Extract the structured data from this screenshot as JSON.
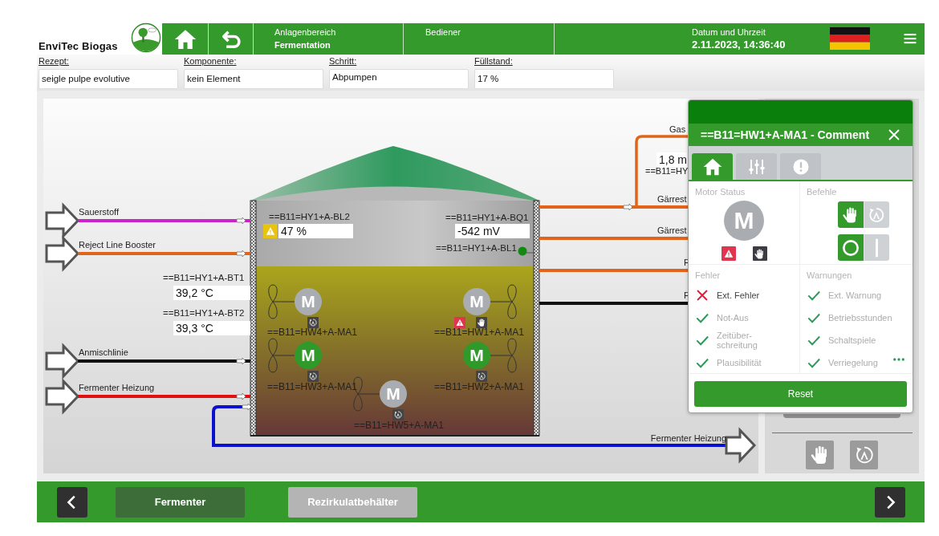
{
  "header": {
    "logo_text": "EnviTec Biogas",
    "area_label": "Anlagenbereich",
    "area_value": "Fermentation",
    "operator_label": "Bediener",
    "datetime_label": "Datum und Uhrzeit",
    "datetime_value": "2.11.2023, 14:36:40"
  },
  "info_fields": [
    {
      "label": "Rezept:",
      "value": "seigle pulpe evolutive"
    },
    {
      "label": "Komponente:",
      "value": "kein Element"
    },
    {
      "label": "Schritt:",
      "value": "Abpumpen"
    },
    {
      "label": "Füllstand:",
      "value": "17 %"
    }
  ],
  "diagram": {
    "inlets": [
      {
        "label": "Sauerstoff",
        "color": "#cc22cc"
      },
      {
        "label": "Reject Line Booster",
        "color": "#e0651a"
      },
      {
        "label": "Anmischlinie",
        "color": "#111111"
      },
      {
        "label": "Fermenter Heizung",
        "color": "#e01010"
      }
    ],
    "outlets": [
      {
        "label": "Gärrest",
        "color": "#e0651a"
      },
      {
        "label": "Gärrest",
        "color": "#e0651a"
      },
      {
        "label": "F",
        "color": "#e0651a"
      },
      {
        "label": "F",
        "color": "#111111"
      }
    ],
    "gas_line": {
      "label": "Gas",
      "value": "1,8 m",
      "tag": "==B11=HY"
    },
    "return_line": {
      "label": "Fermenter Heizung",
      "color": "#0a10d0"
    },
    "sensors": [
      {
        "kind": "value",
        "tag": "==B11=HY1+A-BL2",
        "value": "47 %",
        "warning": true
      },
      {
        "kind": "value",
        "tag": "==B11=HY1+A-BQ1",
        "value": "-542 mV",
        "warning": false
      },
      {
        "kind": "indicator",
        "tag": "==B11=HY1+A-BL1",
        "on": true
      },
      {
        "kind": "value",
        "tag": "==B11=HY1+A-BT1",
        "value": "39,2 °C",
        "warning": false
      },
      {
        "kind": "value",
        "tag": "==B11=HY1+A-BT2",
        "value": "39,3 °C",
        "warning": false
      }
    ],
    "motors": [
      {
        "tag": "==B11=HW4+A-MA1",
        "symbol": "M",
        "running": false,
        "manual": false,
        "error": false
      },
      {
        "tag": "==B11=HW3+A-MA1",
        "symbol": "M",
        "running": true,
        "manual": false,
        "error": false
      },
      {
        "tag": "==B11=HW1+A-MA1",
        "symbol": "M",
        "running": false,
        "manual": true,
        "error": true
      },
      {
        "tag": "==B11=HW2+A-MA1",
        "symbol": "M",
        "running": true,
        "manual": false,
        "error": false
      },
      {
        "tag": "==B11=HW5+A-MA1",
        "symbol": "M",
        "running": false,
        "manual": false,
        "error": false
      }
    ]
  },
  "popup": {
    "title": "==B11=HW1+A-MA1 - Comment",
    "tabs": [
      {
        "kind": "home",
        "selected": true
      },
      {
        "kind": "sliders",
        "selected": false
      },
      {
        "kind": "alert",
        "selected": false
      }
    ],
    "status": {
      "label": "Motor Status",
      "symbol": "M",
      "running": false,
      "error": true,
      "manual": true
    },
    "commands": {
      "label": "Befehle",
      "toggles": [
        {
          "options": [
            {
              "kind": "hand",
              "selected": true
            },
            {
              "kind": "auto",
              "selected": false
            }
          ]
        },
        {
          "options": [
            {
              "kind": "off",
              "selected": true
            },
            {
              "kind": "on",
              "selected": false
            }
          ]
        }
      ]
    },
    "faults": {
      "label": "Fehler",
      "items": [
        {
          "label": "Ext. Fehler",
          "ok": false
        },
        {
          "label": "Not-Aus",
          "ok": true
        },
        {
          "label": "Zeitüber-\nschreitung",
          "ok": true
        },
        {
          "label": "Plausibilität",
          "ok": true
        }
      ]
    },
    "warnings": {
      "label": "Warnungen",
      "more": true,
      "items": [
        {
          "label": "Ext. Warnung",
          "ok": true
        },
        {
          "label": "Betriebsstunden",
          "ok": true
        },
        {
          "label": "Schaltspiele",
          "ok": true
        },
        {
          "label": "Verriegelung",
          "ok": true
        }
      ]
    },
    "reset": "Reset"
  },
  "footer": {
    "tabs": [
      {
        "label": "Fermenter",
        "disabled": false
      },
      {
        "label": "Rezirkulatbehälter",
        "disabled": true
      }
    ]
  }
}
